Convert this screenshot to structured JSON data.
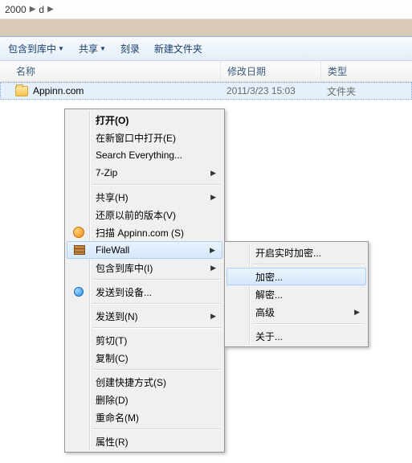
{
  "breadcrumb": {
    "seg1": "2000",
    "seg2": "d"
  },
  "toolbar": {
    "include_in_library": "包含到库中",
    "share": "共享",
    "burn": "刻录",
    "new_folder": "新建文件夹"
  },
  "columns": {
    "name": "名称",
    "modified": "修改日期",
    "type": "类型"
  },
  "file": {
    "name": "Appinn.com",
    "date": "2011/3/23 15:03",
    "type": "文件夹"
  },
  "menu": {
    "open": "打开(O)",
    "open_new_window": "在新窗口中打开(E)",
    "search_everything": "Search Everything...",
    "seven_zip": "7-Zip",
    "share": "共享(H)",
    "restore_prev": "还原以前的版本(V)",
    "scan": "扫描 Appinn.com (S)",
    "filewall": "FileWall",
    "include_in_library": "包含到库中(I)",
    "send_to_device": "发送到设备...",
    "send_to": "发送到(N)",
    "cut": "剪切(T)",
    "copy": "复制(C)",
    "create_shortcut": "创建快捷方式(S)",
    "delete": "删除(D)",
    "rename": "重命名(M)",
    "properties": "属性(R)"
  },
  "submenu": {
    "start_realtime": "开启实时加密...",
    "encrypt": "加密...",
    "decrypt": "解密...",
    "advanced": "高级",
    "about": "关于..."
  }
}
